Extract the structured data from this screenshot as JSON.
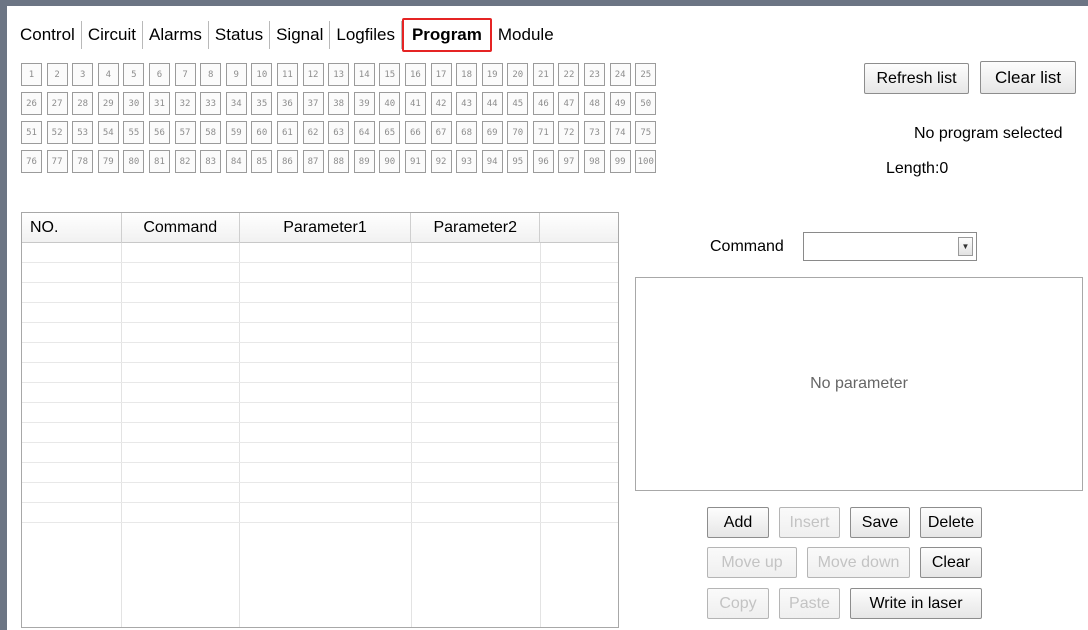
{
  "tabs": [
    {
      "label": "Control"
    },
    {
      "label": "Circuit"
    },
    {
      "label": "Alarms"
    },
    {
      "label": "Status"
    },
    {
      "label": "Signal"
    },
    {
      "label": "Logfiles"
    },
    {
      "label": "Program",
      "active": true
    },
    {
      "label": "Module"
    }
  ],
  "programs": {
    "rows": [
      [
        "1",
        "2",
        "3",
        "4",
        "5",
        "6",
        "7",
        "8",
        "9",
        "10",
        "11",
        "12",
        "13",
        "14",
        "15",
        "16",
        "17",
        "18",
        "19",
        "20",
        "21",
        "22",
        "23",
        "24",
        "25"
      ],
      [
        "26",
        "27",
        "28",
        "29",
        "30",
        "31",
        "32",
        "33",
        "34",
        "35",
        "36",
        "37",
        "38",
        "39",
        "40",
        "41",
        "42",
        "43",
        "44",
        "45",
        "46",
        "47",
        "48",
        "49",
        "50"
      ],
      [
        "51",
        "52",
        "53",
        "54",
        "55",
        "56",
        "57",
        "58",
        "59",
        "60",
        "61",
        "62",
        "63",
        "64",
        "65",
        "66",
        "67",
        "68",
        "69",
        "70",
        "71",
        "72",
        "73",
        "74",
        "75"
      ],
      [
        "76",
        "77",
        "78",
        "79",
        "80",
        "81",
        "82",
        "83",
        "84",
        "85",
        "86",
        "87",
        "88",
        "89",
        "90",
        "91",
        "92",
        "93",
        "94",
        "95",
        "96",
        "97",
        "98",
        "99",
        "100"
      ]
    ]
  },
  "toolbar": {
    "refresh_label": "Refresh list",
    "clear_list_label": "Clear list"
  },
  "program_info": {
    "status": "No program selected",
    "length": "Length:0"
  },
  "table": {
    "headers": [
      "NO.",
      "Command",
      "Parameter1",
      "Parameter2",
      ""
    ]
  },
  "command": {
    "label": "Command",
    "value": ""
  },
  "parameters": {
    "empty_text": "No parameter"
  },
  "actions": {
    "add": "Add",
    "insert": "Insert",
    "save": "Save",
    "delete": "Delete",
    "move_up": "Move up",
    "move_down": "Move down",
    "clear": "Clear",
    "copy": "Copy",
    "paste": "Paste",
    "write": "Write in laser"
  },
  "colors": {
    "active_tab_border": "#e52424",
    "window_frame": "#6c7584",
    "disabled_text": "#c3c3c3"
  }
}
